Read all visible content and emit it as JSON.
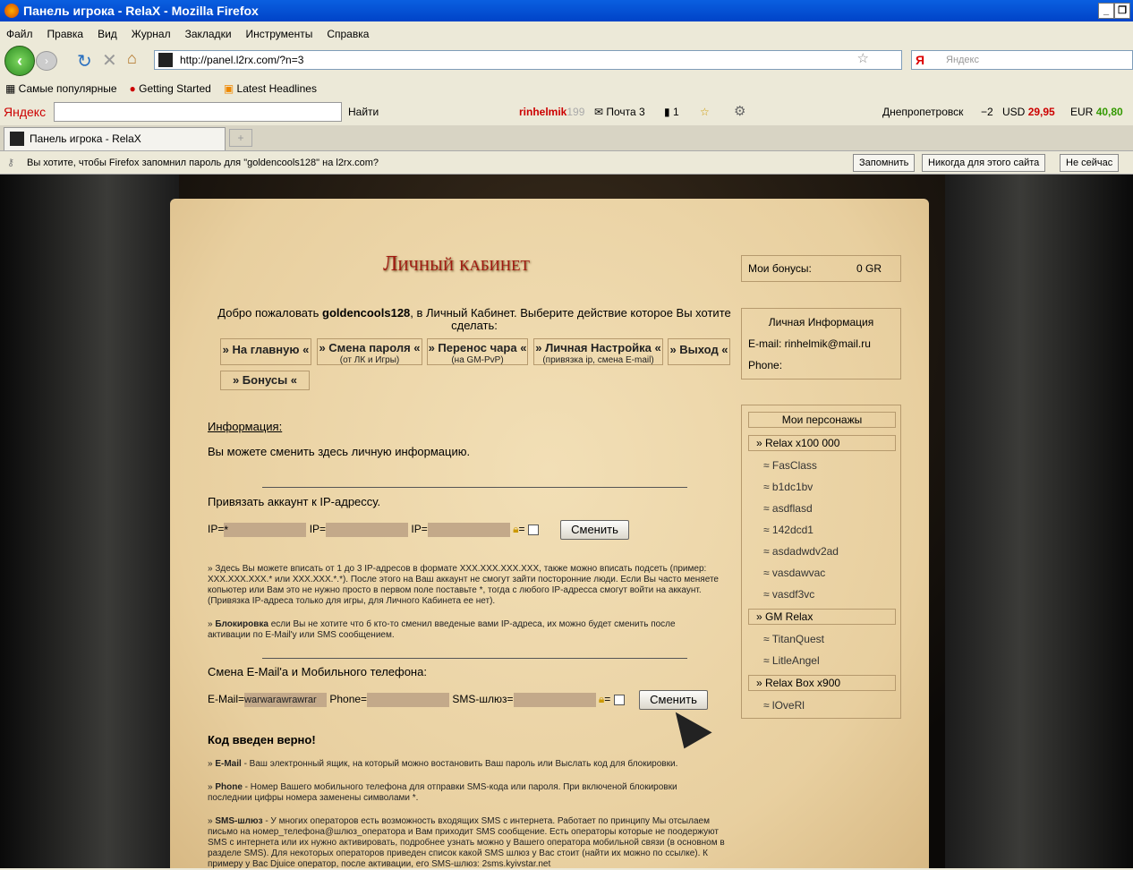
{
  "window": {
    "title": "Панель игрока - RelaX - Mozilla Firefox"
  },
  "menu": [
    "Файл",
    "Правка",
    "Вид",
    "Журнал",
    "Закладки",
    "Инструменты",
    "Справка"
  ],
  "address": {
    "url": "http://panel.l2rx.com/?n=3",
    "search_placeholder": "Яндекс"
  },
  "bookmarks": [
    "Самые популярные",
    "Getting Started",
    "Latest Headlines"
  ],
  "yandex_bar": {
    "logo": "Яндекс",
    "find": "Найти",
    "user": "rinhelmik",
    "user_suffix": "199",
    "mail": "Почта 3",
    "count": "1",
    "city": "Днепропетровск",
    "temp": "−2",
    "usd_label": "USD",
    "usd": "29,95",
    "eur_label": "EUR",
    "eur": "40,80"
  },
  "tabs": [
    {
      "label": "Панель игрока - RelaX"
    }
  ],
  "notification": {
    "text": "Вы хотите, чтобы Firefox запомнил пароль для \"goldencools128\" на l2rx.com?",
    "remember": "Запомнить",
    "never": "Никогда для этого сайта",
    "not_now": "Не сейчас"
  },
  "page": {
    "title": "Личный кабинет",
    "welcome_pre": "Добро пожаловать ",
    "username": "goldencools128",
    "welcome_post": ", в Личный Кабинет. Выберите действие которое Вы хотите сделать:",
    "nav": [
      {
        "label": "» На главную «",
        "sub": ""
      },
      {
        "label": "» Смена пароля «",
        "sub": "(от ЛК и Игры)"
      },
      {
        "label": "» Перенос чара «",
        "sub": "(на GM-PvP)"
      },
      {
        "label": "» Личная Настройка «",
        "sub": "(привязка ip, смена E-mail)"
      },
      {
        "label": "» Выход «",
        "sub": ""
      },
      {
        "label": "» Бонусы «",
        "sub": ""
      }
    ],
    "info_heading": "Информация:",
    "info_text": "Вы можете сменить здесь личную информацию.",
    "ip_heading": "Привязать аккаунт к IP-адрессу.",
    "ip_label": "IP=",
    "ip1": "*",
    "ip_eq": "=",
    "change": "Сменить",
    "ip_help": "Здесь Вы можете вписать от 1 до 3 IP-адресов в формате XXX.XXX.XXX.XXX, также можно вписать подсеть (пример: XXX.XXX.XXX.* или XXX.XXX.*.*). После этого на Ваш аккаунт не смогут зайти посторонние люди. Если Вы часто меняете копьютер или Вам это не нужно просто в первом поле поставьте *, тогда с любого IP-адресса смогут войти на аккаунт. (Привязка IP-адреса только для игры, для Личного Кабинета ее нет).",
    "block_label": "Блокировка",
    "block_text": " если Вы не хотите что б кто-то сменил введеные вами IP-адреса, их можно будет сменить после активации по E-Mail'у или SMS сообщением.",
    "mail_heading": "Смена E-Mail'а и Мобильного телефона:",
    "email_label": "E-Mail=",
    "email_value": "warwarawrawrar",
    "phone_label": "Phone=",
    "sms_label": "SMS-шлюз=",
    "success": "Код введен верно!",
    "help": [
      {
        "term": "E-Mail",
        "text": " - Ваш электронный ящик, на который можно востановить Ваш пароль или Выслать код для блокировки."
      },
      {
        "term": "Phone",
        "text": " - Номер Вашего мобильного телефона для отправки SMS-кода или пароля. При включеной блокировки последнии цифры номера заменены символами *."
      },
      {
        "term": "SMS-шлюз",
        "text": " - У многих операторов есть возможность входящих SMS с интернета. Работает по принципу Мы отсылаем письмо на номер_телефона@шлюз_оператора и Вам приходит SMS сообщение. Есть операторы которые не поодержуют SMS с интернета или их нужно активировать, подробнее узнать можно у Вашего оператора мобильной связи (в основном в разделе SMS). Для некоторых операторов приведен список какой SMS шлюз у Вас стоит (найти их можно по ссылке). К примеру у Вас Djuice оператор, после активации, его SMS-шлюз: 2sms.kyivstar.net"
      }
    ],
    "bonus_label": "Мои бонусы:",
    "bonus_value": "0 GR",
    "personal": {
      "title": "Личная Информация",
      "email": "E-mail: rinhelmik@mail.ru",
      "phone": "Phone:"
    },
    "chars_title": "Мои персонажы",
    "servers": [
      {
        "name": "» Relax x100 000",
        "chars": [
          "FasClass",
          "b1dc1bv",
          "asdflasd",
          "142dcd1",
          "asdadwdv2ad",
          "vasdawvac",
          "vasdf3vc"
        ]
      },
      {
        "name": "» GM Relax",
        "chars": [
          "TitanQuest",
          "LitleAngel"
        ]
      },
      {
        "name": "» Relax Box x900",
        "chars": [
          "lOveRl"
        ]
      }
    ],
    "char_prefix": "≈ "
  }
}
